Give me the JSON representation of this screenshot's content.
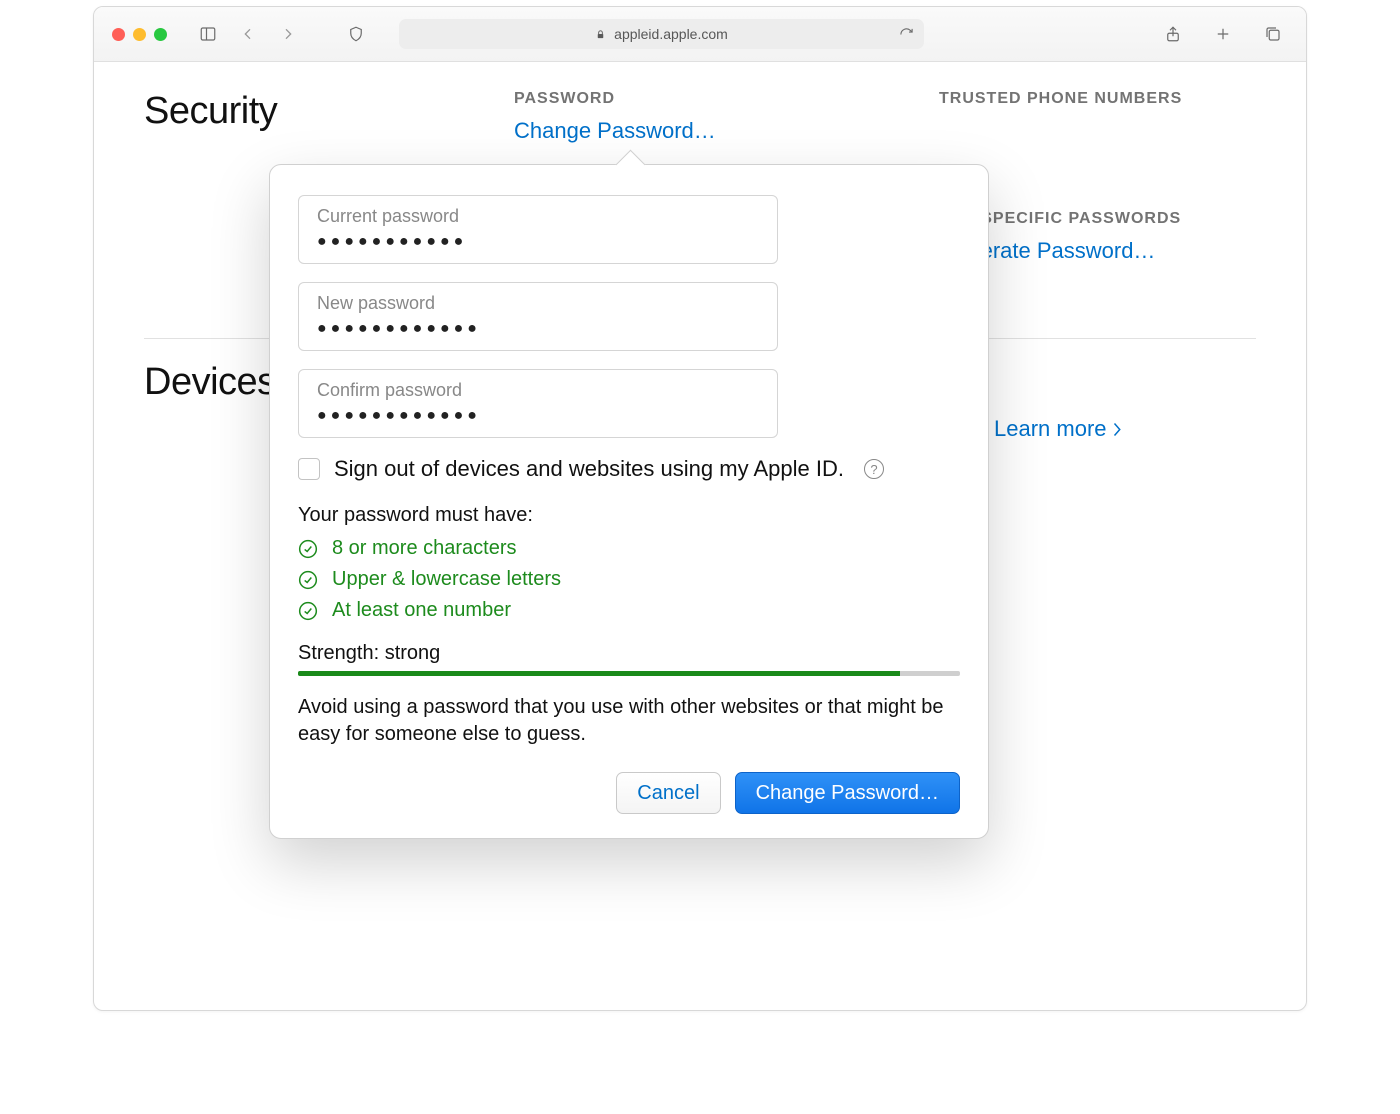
{
  "toolbar": {
    "url": "appleid.apple.com"
  },
  "page": {
    "security_title": "Security",
    "devices_title": "Devices",
    "password_section": {
      "heading": "PASSWORD",
      "link": "Change Password…"
    },
    "trusted_section": {
      "heading": "TRUSTED PHONE NUMBERS"
    },
    "appspec_section": {
      "heading": "APP-SPECIFIC PASSWORDS",
      "link": "Generate Password…"
    },
    "learn_more": "Learn more"
  },
  "popover": {
    "fields": {
      "current": {
        "label": "Current password",
        "value": "●●●●●●●●●●●"
      },
      "new": {
        "label": "New password",
        "value": "●●●●●●●●●●●●"
      },
      "confirm": {
        "label": "Confirm password",
        "value": "●●●●●●●●●●●●"
      }
    },
    "signout_label": "Sign out of devices and websites using my Apple ID.",
    "requirements": {
      "title": "Your password must have:",
      "items": [
        "8 or more characters",
        "Upper & lowercase letters",
        "At least one number"
      ]
    },
    "strength": {
      "label": "Strength: strong",
      "percent": 91
    },
    "advice": "Avoid using a password that you use with other websites or that might be easy for someone else to guess.",
    "cancel": "Cancel",
    "submit": "Change Password…"
  }
}
